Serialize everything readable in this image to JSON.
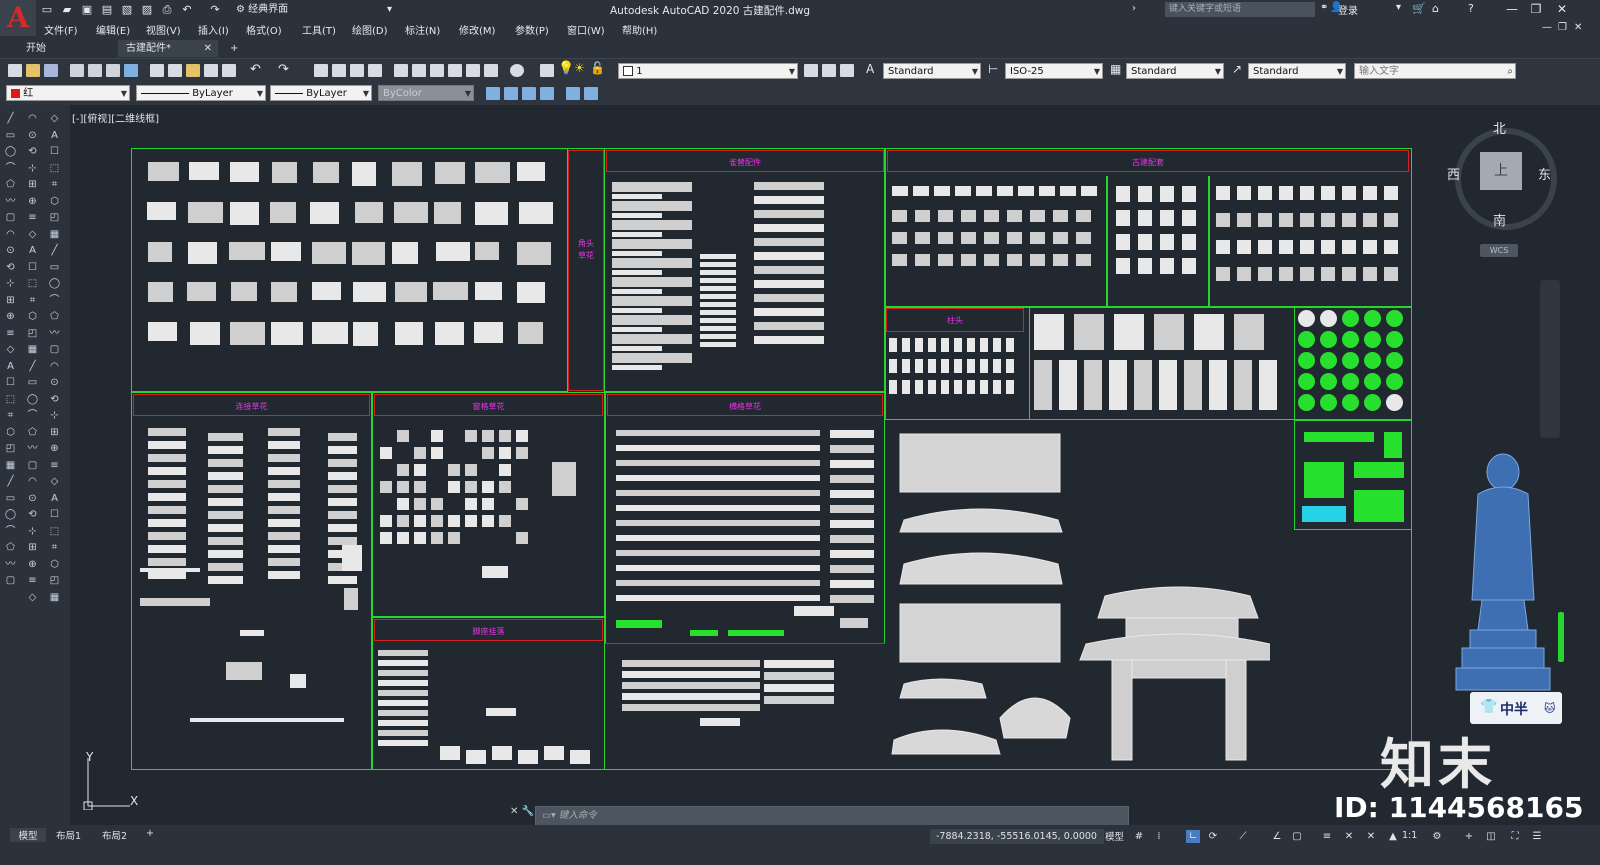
{
  "titlebar": {
    "app_logo": "A",
    "workspace": "经典界面",
    "title": "Autodesk AutoCAD 2020    古建配件.dwg",
    "search_placeholder": "键入关键字或短语",
    "login": "登录"
  },
  "menu": [
    "文件(F)",
    "编辑(E)",
    "视图(V)",
    "插入(I)",
    "格式(O)",
    "工具(T)",
    "绘图(D)",
    "标注(N)",
    "修改(M)",
    "参数(P)",
    "窗口(W)",
    "帮助(H)"
  ],
  "tabs": [
    {
      "label": "开始"
    },
    {
      "label": "古建配件*"
    }
  ],
  "toolbar1": {
    "layer_value": "1",
    "text_style": "Standard",
    "dim_style": "ISO-25",
    "table_style": "Standard",
    "mleader_style": "Standard",
    "find_text_placeholder": "输入文字"
  },
  "toolbar2": {
    "color": "红",
    "linetype": "ByLayer",
    "lineweight": "ByLayer",
    "plot_style": "ByColor"
  },
  "canvas": {
    "view_label": "[-][俯视][二维线框]",
    "section_headers": {
      "jiaotou": "角头草花",
      "queti": "雀替配件",
      "gujian": "古建配套",
      "zhutou": "柱头",
      "lianjie": "连接草花",
      "jianxi": "窗格草花",
      "hengxiang": "横格草花",
      "jiaozuo": "脚座挂落"
    },
    "ucs": {
      "y": "Y",
      "x": "X"
    }
  },
  "viewcube": {
    "north": "北",
    "south": "南",
    "east": "东",
    "west": "西",
    "top_face": "上",
    "wcs": "WCS"
  },
  "command_line": {
    "placeholder": "键入命令"
  },
  "status": {
    "layouts": [
      "模型",
      "布局1",
      "布局2"
    ],
    "add_layout": "+",
    "coordinates": "-7884.2318, -55516.0145, 0.0000",
    "model_button": "模型",
    "scale": "1:1"
  },
  "overlay": {
    "ime": "中半",
    "watermark_logo": "知末",
    "watermark_id": "ID: 1144568165"
  },
  "colors": {
    "accent_green": "#27d52e",
    "header_red": "#d22222",
    "header_text": "#e534e5",
    "canvas_bg": "#212830"
  }
}
